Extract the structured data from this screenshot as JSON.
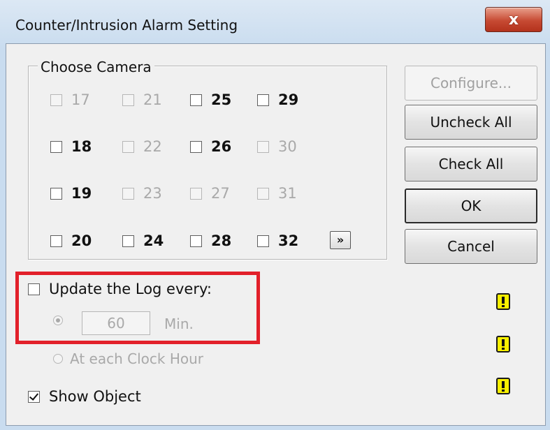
{
  "window": {
    "title": "Counter/Intrusion Alarm Setting",
    "close_label": "x"
  },
  "camera_group": {
    "label": "Choose Camera",
    "cameras": [
      {
        "label": "17",
        "enabled": false,
        "checked": false
      },
      {
        "label": "21",
        "enabled": false,
        "checked": false
      },
      {
        "label": "25",
        "enabled": true,
        "checked": false
      },
      {
        "label": "29",
        "enabled": true,
        "checked": false
      },
      {
        "label": "18",
        "enabled": true,
        "checked": false
      },
      {
        "label": "22",
        "enabled": false,
        "checked": false
      },
      {
        "label": "26",
        "enabled": true,
        "checked": false
      },
      {
        "label": "30",
        "enabled": false,
        "checked": false
      },
      {
        "label": "19",
        "enabled": true,
        "checked": false
      },
      {
        "label": "23",
        "enabled": false,
        "checked": false
      },
      {
        "label": "27",
        "enabled": false,
        "checked": false
      },
      {
        "label": "31",
        "enabled": false,
        "checked": false
      },
      {
        "label": "20",
        "enabled": true,
        "checked": false
      },
      {
        "label": "24",
        "enabled": true,
        "checked": false
      },
      {
        "label": "28",
        "enabled": true,
        "checked": false
      },
      {
        "label": "32",
        "enabled": true,
        "checked": false
      }
    ],
    "next_label": "»"
  },
  "buttons": {
    "configure": "Configure...",
    "uncheck_all": "Uncheck All",
    "check_all": "Check All",
    "ok": "OK",
    "cancel": "Cancel"
  },
  "log": {
    "update_label": "Update the Log every:",
    "update_checked": false,
    "interval_value": "60",
    "interval_unit": "Min.",
    "clock_hour_label": "At each Clock Hour"
  },
  "show_object": {
    "label": "Show Object",
    "checked": true
  },
  "icons": {
    "warning": "warning-icon",
    "accent": "#e2202a",
    "warning_color": "#f7f000"
  }
}
